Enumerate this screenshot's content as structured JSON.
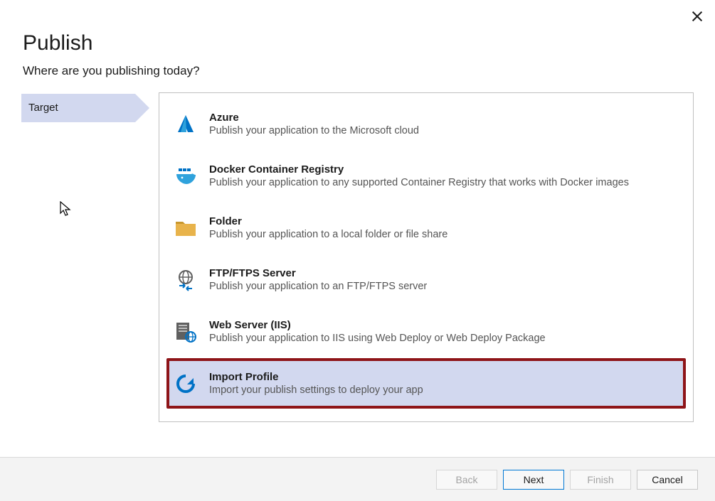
{
  "header": {
    "title": "Publish",
    "subtitle": "Where are you publishing today?"
  },
  "sidebar": {
    "steps": [
      {
        "label": "Target"
      }
    ]
  },
  "targets": [
    {
      "icon": "azure-icon",
      "title": "Azure",
      "desc": "Publish your application to the Microsoft cloud",
      "selected": false
    },
    {
      "icon": "docker-icon",
      "title": "Docker Container Registry",
      "desc": "Publish your application to any supported Container Registry that works with Docker images",
      "selected": false
    },
    {
      "icon": "folder-icon",
      "title": "Folder",
      "desc": "Publish your application to a local folder or file share",
      "selected": false
    },
    {
      "icon": "ftp-icon",
      "title": "FTP/FTPS Server",
      "desc": "Publish your application to an FTP/FTPS server",
      "selected": false
    },
    {
      "icon": "iis-icon",
      "title": "Web Server (IIS)",
      "desc": "Publish your application to IIS using Web Deploy or Web Deploy Package",
      "selected": false
    },
    {
      "icon": "import-icon",
      "title": "Import Profile",
      "desc": "Import your publish settings to deploy your app",
      "selected": true
    }
  ],
  "footer": {
    "back": "Back",
    "next": "Next",
    "finish": "Finish",
    "cancel": "Cancel"
  }
}
